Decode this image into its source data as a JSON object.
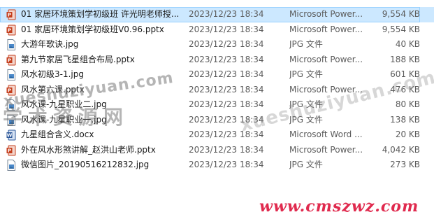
{
  "files": [
    {
      "name": "01 家居环境策划学初级班 许光明老师授...",
      "date": "2023/12/23 18:34",
      "type": "Microsoft Power...",
      "size": "9,554 KB",
      "icon": "pptx-icon",
      "selected": true
    },
    {
      "name": "01 家居环境策划学初级班V0.96.pptx",
      "date": "2023/12/23 18:34",
      "type": "Microsoft Power...",
      "size": "9,554 KB",
      "icon": "pptx-icon",
      "selected": false
    },
    {
      "name": "大游年歌诀.jpg",
      "date": "2023/12/23 18:34",
      "type": "JPG 文件",
      "size": "40 KB",
      "icon": "jpg-icon",
      "selected": false
    },
    {
      "name": "第九节家居飞星组合布局.pptx",
      "date": "2023/12/23 18:34",
      "type": "Microsoft Power...",
      "size": "188 KB",
      "icon": "pptx-icon",
      "selected": false
    },
    {
      "name": "风水初级3-1.jpg",
      "date": "2023/12/23 18:34",
      "type": "JPG 文件",
      "size": "601 KB",
      "icon": "jpg-icon",
      "selected": false
    },
    {
      "name": "风水第六课.pptx",
      "date": "2023/12/23 18:34",
      "type": "Microsoft Power...",
      "size": "476 KB",
      "icon": "pptx-icon",
      "selected": false
    },
    {
      "name": "风水课-九星职业二.jpg",
      "date": "2023/12/23 18:34",
      "type": "JPG 文件",
      "size": "80 KB",
      "icon": "jpg-icon",
      "selected": false
    },
    {
      "name": "风水课-九星职业一.jpg",
      "date": "2023/12/23 18:34",
      "type": "JPG 文件",
      "size": "138 KB",
      "icon": "jpg-icon",
      "selected": false
    },
    {
      "name": "九星组合含义.docx",
      "date": "2023/12/23 18:34",
      "type": "Microsoft Word ...",
      "size": "20 KB",
      "icon": "docx-icon",
      "selected": false
    },
    {
      "name": "外在风水形煞讲解_赵洪山老师.pptx",
      "date": "2023/12/23 18:34",
      "type": "Microsoft Power...",
      "size": "4,042 KB",
      "icon": "pptx-icon",
      "selected": false
    },
    {
      "name": "微信图片_20190516212832.jpg",
      "date": "2023/12/23 18:34",
      "type": "JPG 文件",
      "size": "273 KB",
      "icon": "jpg-icon",
      "selected": false
    }
  ],
  "watermarks": {
    "text1": "xueshuziyuan.com",
    "text2": "学术资源网",
    "text3": "xueshuziyuan.com",
    "site": "www.cmszwz.com"
  },
  "colors": {
    "selection": "#cce8ff",
    "pptx": "#c43e1c",
    "docx": "#2b579a",
    "jpg": "#4a88c9",
    "site_watermark": "#e02a4e"
  }
}
